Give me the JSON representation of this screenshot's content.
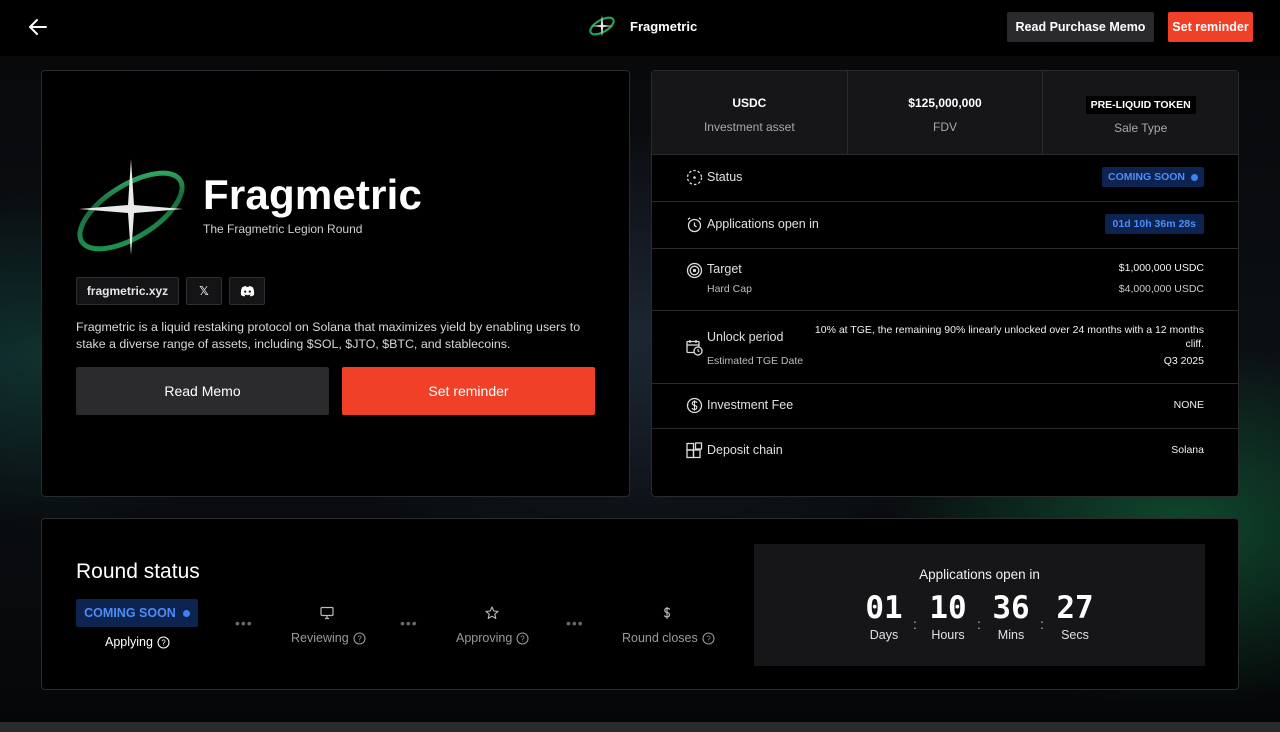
{
  "header": {
    "project_name": "Fragmetric",
    "read_purchase_memo": "Read Purchase Memo",
    "set_reminder": "Set reminder"
  },
  "project": {
    "title": "Fragmetric",
    "subtitle": "The Fragmetric Legion Round",
    "website": "fragmetric.xyz",
    "x_glyph": "𝕏",
    "description": "Fragmetric is a liquid restaking protocol on Solana that maximizes yield by enabling users to stake a diverse range of assets, including $SOL, $JTO, $BTC, and stablecoins.",
    "read_memo": "Read Memo",
    "set_reminder": "Set reminder"
  },
  "stats": [
    {
      "value": "USDC",
      "label": "Investment asset"
    },
    {
      "value": "$125,000,000",
      "label": "FDV"
    },
    {
      "value": "PRE-LIQUID TOKEN",
      "label": "Sale Type"
    }
  ],
  "details": {
    "status": {
      "label": "Status",
      "badge": "COMING SOON"
    },
    "applications": {
      "label": "Applications open in",
      "value": "01d 10h 36m 28s"
    },
    "target": {
      "label": "Target",
      "value": "$1,000,000 USDC",
      "sub_label": "Hard Cap",
      "sub_value": "$4,000,000 USDC"
    },
    "unlock": {
      "label": "Unlock period",
      "value": "10% at TGE, the remaining 90% linearly unlocked over 24 months with a 12 months cliff.",
      "sub_label": "Estimated TGE Date",
      "sub_value": "Q3 2025"
    },
    "fee": {
      "label": "Investment Fee",
      "value": "NONE"
    },
    "chain": {
      "label": "Deposit chain",
      "value": "Solana"
    }
  },
  "round": {
    "title": "Round status",
    "badge": "COMING SOON",
    "steps": [
      "Applying",
      "Reviewing",
      "Approving",
      "Round closes"
    ],
    "countdown_title": "Applications open in",
    "countdown": [
      {
        "value": "01",
        "unit": "Days"
      },
      {
        "value": "10",
        "unit": "Hours"
      },
      {
        "value": "36",
        "unit": "Mins"
      },
      {
        "value": "27",
        "unit": "Secs"
      }
    ]
  },
  "colors": {
    "accent": "#f04028",
    "badge_bg": "#0d2450",
    "badge_text": "#4d8df7",
    "logo_green": "#22a45a"
  }
}
